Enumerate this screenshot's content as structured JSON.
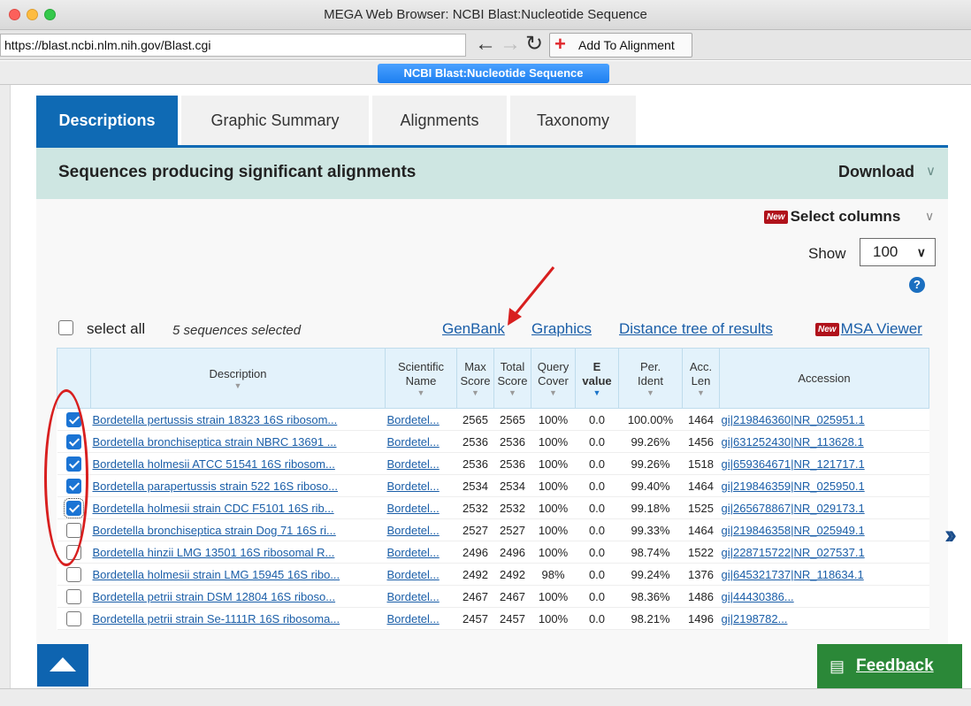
{
  "window": {
    "title": "MEGA Web Browser: NCBI Blast:Nucleotide Sequence",
    "url": "https://blast.ncbi.nlm.nih.gov/Blast.cgi",
    "add_button_label": "Add To Alignment",
    "tab_label": "NCBI Blast:Nucleotide Sequence"
  },
  "icons": {
    "back": "left-arrow",
    "forward": "right-arrow",
    "reload": "reload",
    "add": "plus",
    "help": "question-circle",
    "next": "double-chevron-right",
    "scroll_top": "triangle-up",
    "feedback": "message-bubble"
  },
  "tabs": [
    {
      "label": "Descriptions",
      "active": true
    },
    {
      "label": "Graphic Summary",
      "active": false
    },
    {
      "label": "Alignments",
      "active": false
    },
    {
      "label": "Taxonomy",
      "active": false
    }
  ],
  "section": {
    "title": "Sequences producing significant alignments",
    "download_label": "Download"
  },
  "controls": {
    "new_badge": "New",
    "select_columns": "Select columns",
    "show_label": "Show",
    "show_value": "100",
    "help_glyph": "?",
    "select_all": "select all",
    "selected_count": "5 sequences selected",
    "links": {
      "genbank": "GenBank",
      "graphics": "Graphics",
      "tree": "Distance tree of results",
      "msa": "MSA Viewer"
    }
  },
  "table": {
    "headers": {
      "description": "Description",
      "scientific_name_1": "Scientific",
      "scientific_name_2": "Name",
      "max_score_1": "Max",
      "max_score_2": "Score",
      "total_score_1": "Total",
      "total_score_2": "Score",
      "query_cover_1": "Query",
      "query_cover_2": "Cover",
      "evalue_1": "E",
      "evalue_2": "value",
      "per_ident_1": "Per.",
      "per_ident_2": "Ident",
      "acc_len_1": "Acc.",
      "acc_len_2": "Len",
      "accession": "Accession"
    },
    "rows": [
      {
        "checked": true,
        "focused": false,
        "description": "Bordetella pertussis strain 18323 16S ribosom...",
        "scientific_name": "Bordetel...",
        "max_score": "2565",
        "total_score": "2565",
        "query_cover": "100%",
        "evalue": "0.0",
        "per_ident": "100.00%",
        "acc_len": "1464",
        "accession": "gi|219846360|NR_025951.1"
      },
      {
        "checked": true,
        "focused": false,
        "description": "Bordetella bronchiseptica strain NBRC 13691 ...",
        "scientific_name": "Bordetel...",
        "max_score": "2536",
        "total_score": "2536",
        "query_cover": "100%",
        "evalue": "0.0",
        "per_ident": "99.26%",
        "acc_len": "1456",
        "accession": "gi|631252430|NR_113628.1"
      },
      {
        "checked": true,
        "focused": false,
        "description": "Bordetella holmesii ATCC 51541 16S ribosom...",
        "scientific_name": "Bordetel...",
        "max_score": "2536",
        "total_score": "2536",
        "query_cover": "100%",
        "evalue": "0.0",
        "per_ident": "99.26%",
        "acc_len": "1518",
        "accession": "gi|659364671|NR_121717.1"
      },
      {
        "checked": true,
        "focused": false,
        "description": "Bordetella parapertussis strain 522 16S riboso...",
        "scientific_name": "Bordetel...",
        "max_score": "2534",
        "total_score": "2534",
        "query_cover": "100%",
        "evalue": "0.0",
        "per_ident": "99.40%",
        "acc_len": "1464",
        "accession": "gi|219846359|NR_025950.1"
      },
      {
        "checked": true,
        "focused": true,
        "description": "Bordetella holmesii strain CDC F5101 16S rib...",
        "scientific_name": "Bordetel...",
        "max_score": "2532",
        "total_score": "2532",
        "query_cover": "100%",
        "evalue": "0.0",
        "per_ident": "99.18%",
        "acc_len": "1525",
        "accession": "gi|265678867|NR_029173.1"
      },
      {
        "checked": false,
        "focused": false,
        "description": "Bordetella bronchiseptica strain Dog 71 16S ri...",
        "scientific_name": "Bordetel...",
        "max_score": "2527",
        "total_score": "2527",
        "query_cover": "100%",
        "evalue": "0.0",
        "per_ident": "99.33%",
        "acc_len": "1464",
        "accession": "gi|219846358|NR_025949.1"
      },
      {
        "checked": false,
        "focused": false,
        "description": "Bordetella hinzii LMG 13501 16S ribosomal R...",
        "scientific_name": "Bordetel...",
        "max_score": "2496",
        "total_score": "2496",
        "query_cover": "100%",
        "evalue": "0.0",
        "per_ident": "98.74%",
        "acc_len": "1522",
        "accession": "gi|228715722|NR_027537.1"
      },
      {
        "checked": false,
        "focused": false,
        "description": "Bordetella holmesii strain LMG 15945 16S ribo...",
        "scientific_name": "Bordetel...",
        "max_score": "2492",
        "total_score": "2492",
        "query_cover": "98%",
        "evalue": "0.0",
        "per_ident": "99.24%",
        "acc_len": "1376",
        "accession": "gi|645321737|NR_118634.1"
      },
      {
        "checked": false,
        "focused": false,
        "description": "Bordetella petrii strain DSM 12804 16S riboso...",
        "scientific_name": "Bordetel...",
        "max_score": "2467",
        "total_score": "2467",
        "query_cover": "100%",
        "evalue": "0.0",
        "per_ident": "98.36%",
        "acc_len": "1486",
        "accession": "gi|44430386..."
      },
      {
        "checked": false,
        "focused": false,
        "description": "Bordetella petrii strain Se-1111R 16S ribosoma...",
        "scientific_name": "Bordetel...",
        "max_score": "2457",
        "total_score": "2457",
        "query_cover": "100%",
        "evalue": "0.0",
        "per_ident": "98.21%",
        "acc_len": "1496",
        "accession": "gi|2198782..."
      }
    ]
  },
  "feedback_label": "Feedback",
  "colors": {
    "accent_blue": "#0f6ab4",
    "header_teal": "#cee6e2",
    "annotation_red": "#d81f1f",
    "feedback_green": "#2b8838",
    "link_blue": "#1a5ea8"
  }
}
